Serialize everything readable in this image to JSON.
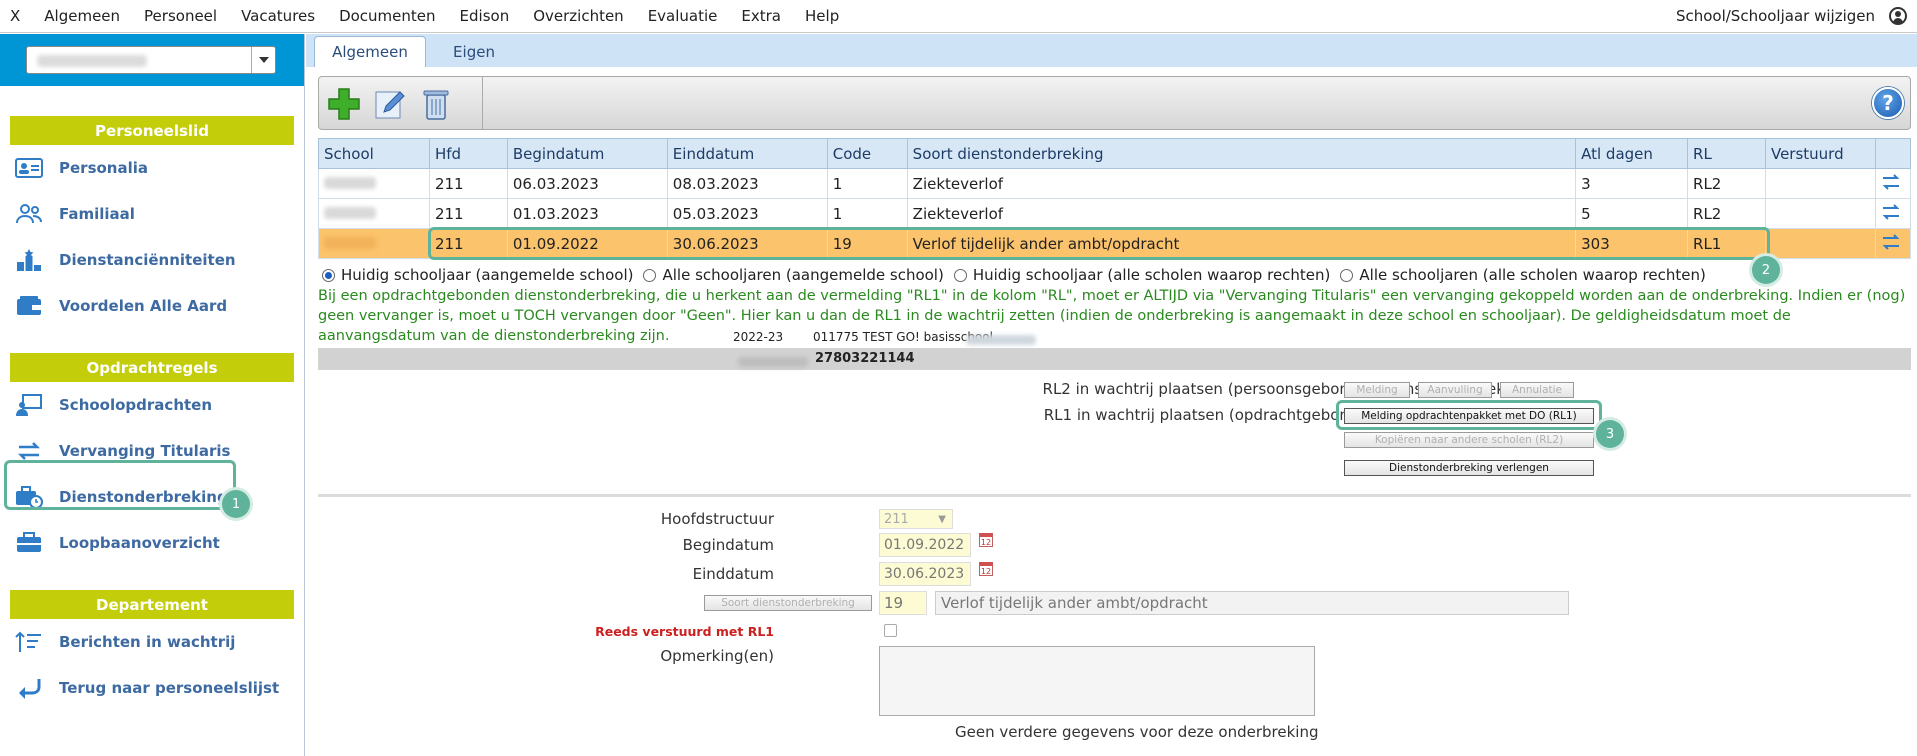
{
  "menubar": {
    "items": [
      "X",
      "Algemeen",
      "Personeel",
      "Vacatures",
      "Documenten",
      "Edison",
      "Overzichten",
      "Evaluatie",
      "Extra",
      "Help"
    ],
    "right_label": "School/Schooljaar wijzigen"
  },
  "sidebar": {
    "sections": [
      {
        "title": "Personeelslid",
        "items": [
          "Personalia",
          "Familiaal",
          "Dienstanciënniteiten",
          "Voordelen Alle Aard"
        ]
      },
      {
        "title": "Opdrachtregels",
        "items": [
          "Schoolopdrachten",
          "Vervanging Titularis",
          "Dienstonderbrekingen",
          "Loopbaanoverzicht"
        ]
      },
      {
        "title": "Departement",
        "items": [
          "Berichten in wachtrij",
          "Terug naar personeelslijst"
        ]
      }
    ],
    "badge_1": "1"
  },
  "tabs": [
    "Algemeen",
    "Eigen"
  ],
  "toolbar": {
    "help_label": "?"
  },
  "table": {
    "headers": [
      "School",
      "Hfd",
      "Begindatum",
      "Einddatum",
      "Code",
      "Soort dienstonderbreking",
      "Atl dagen",
      "RL",
      "Verstuurd"
    ],
    "rows": [
      {
        "hfd": "211",
        "begin": "06.03.2023",
        "einde": "08.03.2023",
        "code": "1",
        "soort": "Ziekteverlof",
        "dagen": "3",
        "rl": "RL2",
        "verstuurd": ""
      },
      {
        "hfd": "211",
        "begin": "01.03.2023",
        "einde": "05.03.2023",
        "code": "1",
        "soort": "Ziekteverlof",
        "dagen": "5",
        "rl": "RL2",
        "verstuurd": ""
      },
      {
        "hfd": "211",
        "begin": "01.09.2022",
        "einde": "30.06.2023",
        "code": "19",
        "soort": "Verlof tijdelijk ander ambt/opdracht",
        "dagen": "303",
        "rl": "RL1",
        "verstuurd": ""
      }
    ],
    "badge_2": "2"
  },
  "radios": {
    "options": [
      "Huidig schooljaar (aangemelde school)",
      "Alle schooljaren (aangemelde school)",
      "Huidig schooljaar (alle scholen waarop rechten)",
      "Alle schooljaren (alle scholen waarop rechten)"
    ],
    "selected_index": 0
  },
  "info_text": "Bij een opdrachtgebonden dienstonderbreking, die u herkent aan de vermelding \"RL1\" in de kolom \"RL\", moet er ALTIJD via \"Vervanging Titularis\" een vervanging gekoppeld worden aan de onderbreking. Indien er (nog) geen vervanger is, moet u TOCH vervangen door \"Geen\". Hier kan u dan de RL1 in de wachtrij zetten (indien de onderbreking is aangemaakt in deze school en schooljaar). De geldigheidsdatum moet de aanvangsdatum van de dienstonderbreking zijn.",
  "strip": {
    "year": "2022-23",
    "school": "011775 TEST GO! basisschool",
    "number": "27803221144"
  },
  "actions": {
    "rl2_label": "RL2 in wachtrij plaatsen (persoonsgebonden dienstonderbreking)",
    "rl1_label": "RL1 in wachtrij plaatsen (opdrachtgebonden dienstonderbreking)",
    "btn_melding": "Melding",
    "btn_aanvulling": "Aanvulling",
    "btn_annulatie": "Annulatie",
    "btn_melding_rl1": "Melding opdrachtenpakket met DO (RL1)",
    "btn_kopieren": "Kopiëren naar andere scholen (RL2)",
    "btn_verlengen": "Dienstonderbreking verlengen",
    "badge_3": "3"
  },
  "form": {
    "hoofdstructuur_label": "Hoofdstructuur",
    "hoofdstructuur_value": "211",
    "begindatum_label": "Begindatum",
    "begindatum_value": "01.09.2022",
    "einddatum_label": "Einddatum",
    "einddatum_value": "30.06.2023",
    "soort_button": "Soort dienstonderbreking",
    "soort_code": "19",
    "soort_text": "Verlof tijdelijk ander ambt/opdracht",
    "reeds_label": "Reeds verstuurd met RL1",
    "opmerking_label": "Opmerking(en)",
    "footer": "Geen verdere gegevens voor deze onderbreking"
  },
  "colors": {
    "accent_blue": "#0096d6",
    "section_green": "#c3cd0a",
    "highlight": "#5fb39b",
    "selected_row": "#fbc36b",
    "info_green": "#2a8a1f"
  }
}
